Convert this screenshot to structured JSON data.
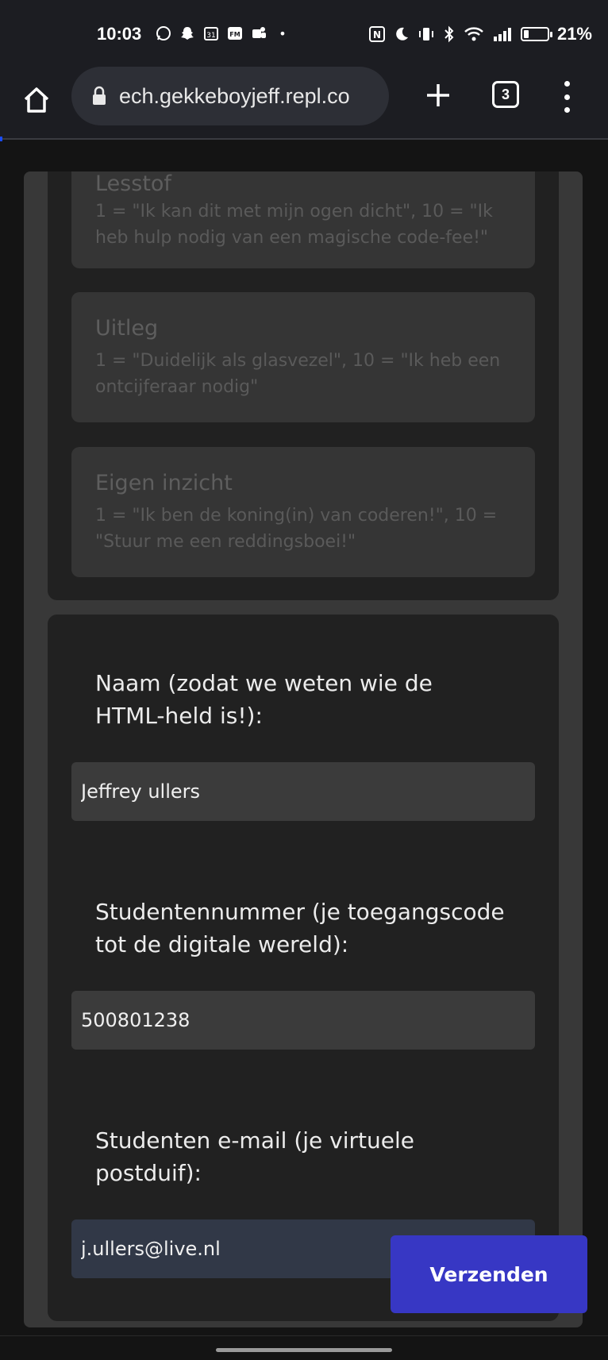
{
  "status_bar": {
    "time": "10:03",
    "left_icons": [
      "whatsapp-icon",
      "snapchat-icon",
      "calendar-icon",
      "fm-icon",
      "teams-icon",
      "dot-icon"
    ],
    "calendar_day": "31",
    "fm_label": "FM",
    "dot": "•",
    "right_icons": [
      "nfc-icon",
      "moon-icon",
      "vibrate-icon",
      "bluetooth-icon",
      "wifi-icon",
      "signal-icon",
      "battery-icon"
    ],
    "nfc_label": "N",
    "battery_level": 0.21,
    "battery_text": "21%"
  },
  "browser": {
    "url": "ech.gekkeboyjeff.repl.co",
    "tab_count": "3"
  },
  "ratings": [
    {
      "title": "Lesstof",
      "desc": "1 = \"Ik kan dit met mijn ogen dicht\", 10 = \"Ik heb hulp nodig van een magische code-fee!\""
    },
    {
      "title": "Uitleg",
      "desc": "1 = \"Duidelijk als glasvezel\", 10 = \"Ik heb een ontcijferaar nodig\""
    },
    {
      "title": "Eigen inzicht",
      "desc": "1 = \"Ik ben de koning(in) van coderen!\", 10 = \"Stuur me een reddingsboei!\""
    }
  ],
  "form": {
    "name_label": "Naam (zodat we weten wie de HTML-held is!):",
    "name_value": "Jeffrey ullers",
    "student_number_label": "Studentennummer (je toegangscode tot de digitale wereld):",
    "student_number_value": "500801238",
    "email_label": "Studenten e-mail (je virtuele postduif):",
    "email_value": "j.ullers@live.nl",
    "submit_label": "Verzenden"
  },
  "colors": {
    "accent": "#3737c4",
    "background": "#141414",
    "panel": "#212121"
  }
}
